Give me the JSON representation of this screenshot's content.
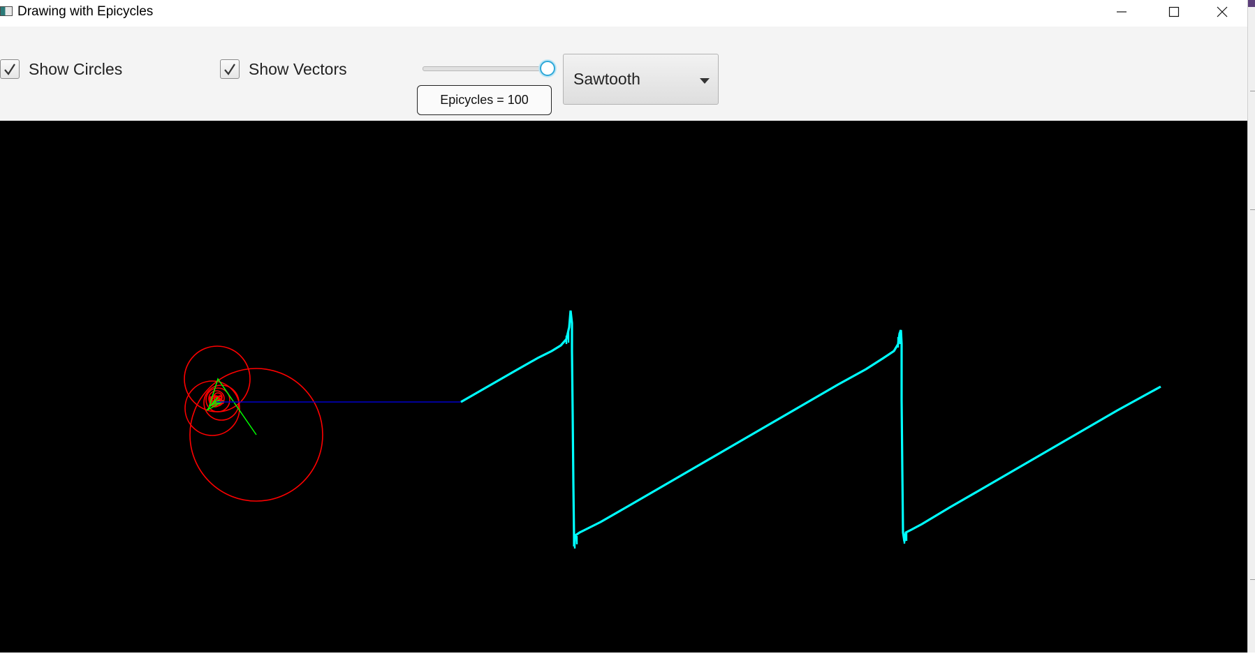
{
  "window": {
    "title": "Drawing with Epicycles",
    "controls": [
      "minimize-icon",
      "maximize-icon",
      "close-icon"
    ]
  },
  "toolbar": {
    "show_circles": {
      "label": "Show Circles",
      "checked": true
    },
    "show_vectors": {
      "label": "Show Vectors",
      "checked": true
    },
    "slider": {
      "value_fraction": 1.0
    },
    "epicycles_label": "Epicycles = 100",
    "waveform_select": {
      "selected": "Sawtooth",
      "icon": "chevron-down-icon"
    }
  },
  "canvas": {
    "background": "#000000",
    "colors": {
      "circles": "#ff0000",
      "vectors": "#00ff00",
      "connector": "#0000cc",
      "trace": "#00ffff"
    }
  },
  "side_strip": {
    "accent": "#5b3f7a"
  }
}
